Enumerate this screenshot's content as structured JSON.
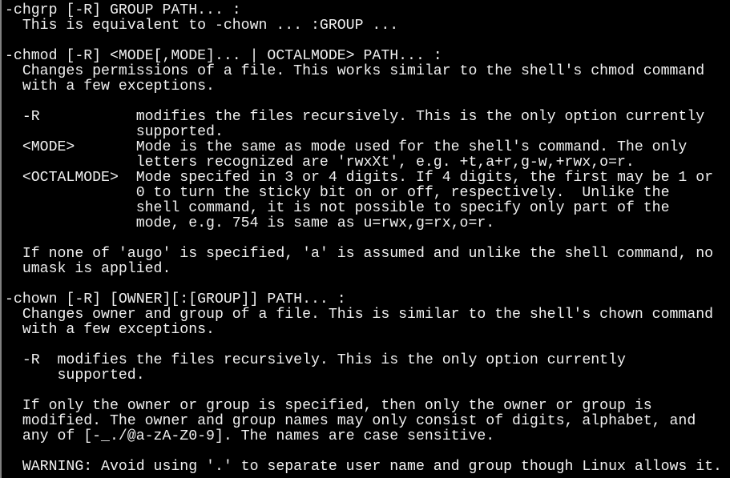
{
  "terminal": {
    "lines": [
      "-chgrp [-R] GROUP PATH... :",
      "  This is equivalent to -chown ... :GROUP ...",
      "",
      "-chmod [-R] <MODE[,MODE]... | OCTALMODE> PATH... :",
      "  Changes permissions of a file. This works similar to the shell's chmod command",
      "  with a few exceptions.",
      "",
      "  -R           modifies the files recursively. This is the only option currently",
      "               supported.",
      "  <MODE>       Mode is the same as mode used for the shell's command. The only",
      "               letters recognized are 'rwxXt', e.g. +t,a+r,g-w,+rwx,o=r.",
      "  <OCTALMODE>  Mode specifed in 3 or 4 digits. If 4 digits, the first may be 1 or",
      "               0 to turn the sticky bit on or off, respectively.  Unlike the",
      "               shell command, it is not possible to specify only part of the",
      "               mode, e.g. 754 is same as u=rwx,g=rx,o=r.",
      "",
      "  If none of 'augo' is specified, 'a' is assumed and unlike the shell command, no",
      "  umask is applied.",
      "",
      "-chown [-R] [OWNER][:[GROUP]] PATH... :",
      "  Changes owner and group of a file. This is similar to the shell's chown command",
      "  with a few exceptions.",
      "",
      "  -R  modifies the files recursively. This is the only option currently",
      "      supported.",
      "",
      "  If only the owner or group is specified, then only the owner or group is",
      "  modified. The owner and group names may only consist of digits, alphabet, and",
      "  any of [-_./@a-zA-Z0-9]. The names are case sensitive.",
      "",
      "  WARNING: Avoid using '.' to separate user name and group though Linux allows it."
    ]
  }
}
